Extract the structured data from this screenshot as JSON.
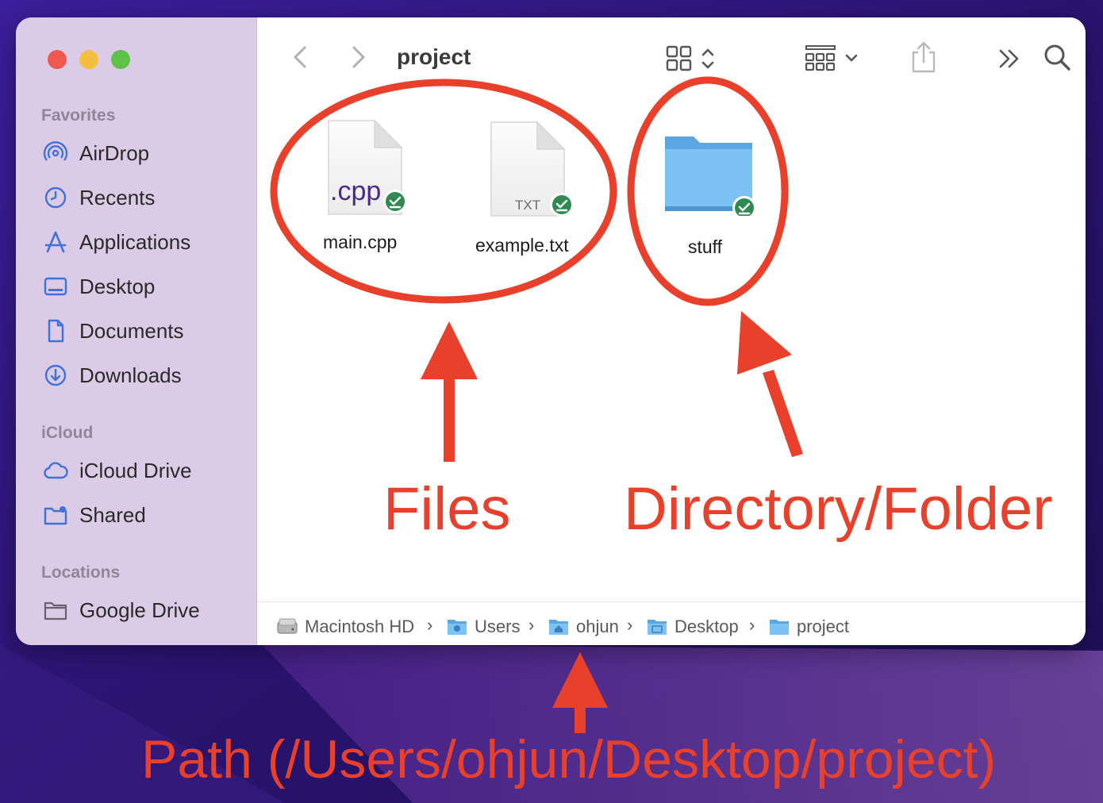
{
  "window": {
    "title": "project",
    "traffic_lights": {
      "close": "#ee5a52",
      "minimize": "#f4bf3f",
      "zoom": "#5fc248"
    }
  },
  "sidebar": {
    "sections": [
      {
        "label": "Favorites",
        "items": [
          {
            "label": "AirDrop",
            "icon": "airdrop-icon"
          },
          {
            "label": "Recents",
            "icon": "clock-icon"
          },
          {
            "label": "Applications",
            "icon": "applications-icon"
          },
          {
            "label": "Desktop",
            "icon": "desktop-icon"
          },
          {
            "label": "Documents",
            "icon": "document-icon"
          },
          {
            "label": "Downloads",
            "icon": "download-icon"
          }
        ]
      },
      {
        "label": "iCloud",
        "items": [
          {
            "label": "iCloud Drive",
            "icon": "cloud-icon"
          },
          {
            "label": "Shared",
            "icon": "shared-folder-icon"
          }
        ]
      },
      {
        "label": "Locations",
        "items": [
          {
            "label": "Google Drive",
            "icon": "folder-icon"
          }
        ]
      }
    ]
  },
  "toolbar": {
    "icons": [
      "back-icon",
      "forward-icon",
      "icon-view-icon",
      "group-icon",
      "share-icon",
      "more-icon",
      "search-icon"
    ]
  },
  "files": [
    {
      "name": "main.cpp",
      "badge": ".cpp",
      "type": "file"
    },
    {
      "name": "example.txt",
      "badge": "TXT",
      "type": "file"
    },
    {
      "name": "stuff",
      "type": "folder"
    }
  ],
  "path": [
    "Macintosh HD",
    "Users",
    "ohjun",
    "Desktop",
    "project"
  ],
  "annotations": {
    "files_label": "Files",
    "folder_label": "Directory/Folder",
    "path_label": "Path (/Users/ohjun/Desktop/project)",
    "color": "#e8402a"
  }
}
